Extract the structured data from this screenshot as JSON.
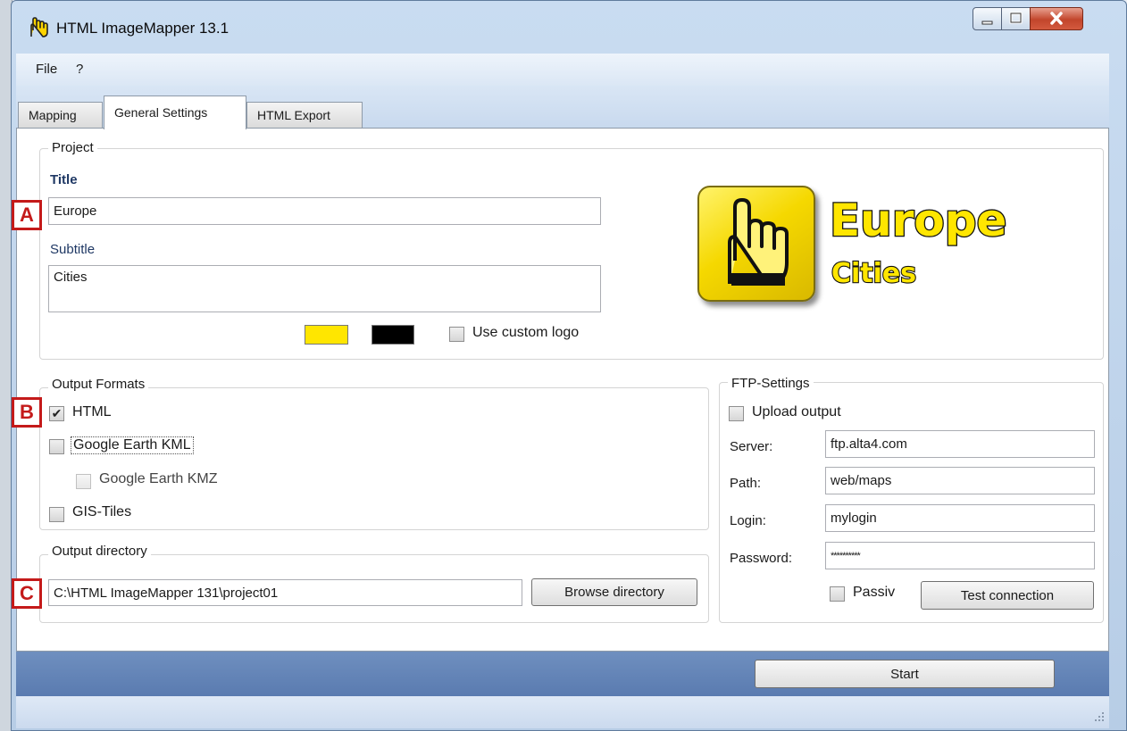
{
  "window": {
    "title": "HTML ImageMapper 13.1",
    "icon": "pointing-hand-icon"
  },
  "menu": [
    "File",
    "?"
  ],
  "tabs": [
    {
      "label": "Mapping",
      "active": false
    },
    {
      "label": "General Settings",
      "active": true
    },
    {
      "label": "HTML Export",
      "active": false
    }
  ],
  "project": {
    "group_label": "Project",
    "title_label": "Title",
    "title_value": "Europe",
    "subtitle_label": "Subtitle",
    "subtitle_value": "Cities",
    "color_primary": "#ffe600",
    "color_secondary": "#000000",
    "custom_logo_label": "Use custom logo",
    "custom_logo_checked": false,
    "logo_title": "Europe",
    "logo_subtitle": "Cities"
  },
  "output_formats": {
    "group_label": "Output Formats",
    "items": [
      {
        "label": "HTML",
        "checked": true,
        "enabled": true
      },
      {
        "label": "Google Earth KML",
        "checked": false,
        "enabled": true
      },
      {
        "label": "Google Earth KMZ",
        "checked": false,
        "enabled": false
      },
      {
        "label": "GIS-Tiles",
        "checked": false,
        "enabled": true
      }
    ]
  },
  "output_directory": {
    "group_label": "Output directory",
    "path": "C:\\HTML ImageMapper 131\\project01",
    "browse_label": "Browse directory"
  },
  "ftp": {
    "group_label": "FTP-Settings",
    "upload_label": "Upload output",
    "upload_checked": false,
    "server_label": "Server:",
    "server_value": "ftp.alta4.com",
    "path_label": "Path:",
    "path_value": "web/maps",
    "login_label": "Login:",
    "login_value": "mylogin",
    "password_label": "Password:",
    "password_value": "**********",
    "passive_label": "Passiv",
    "passive_checked": false,
    "test_label": "Test connection"
  },
  "start_label": "Start",
  "markers": [
    "A",
    "B",
    "C"
  ]
}
